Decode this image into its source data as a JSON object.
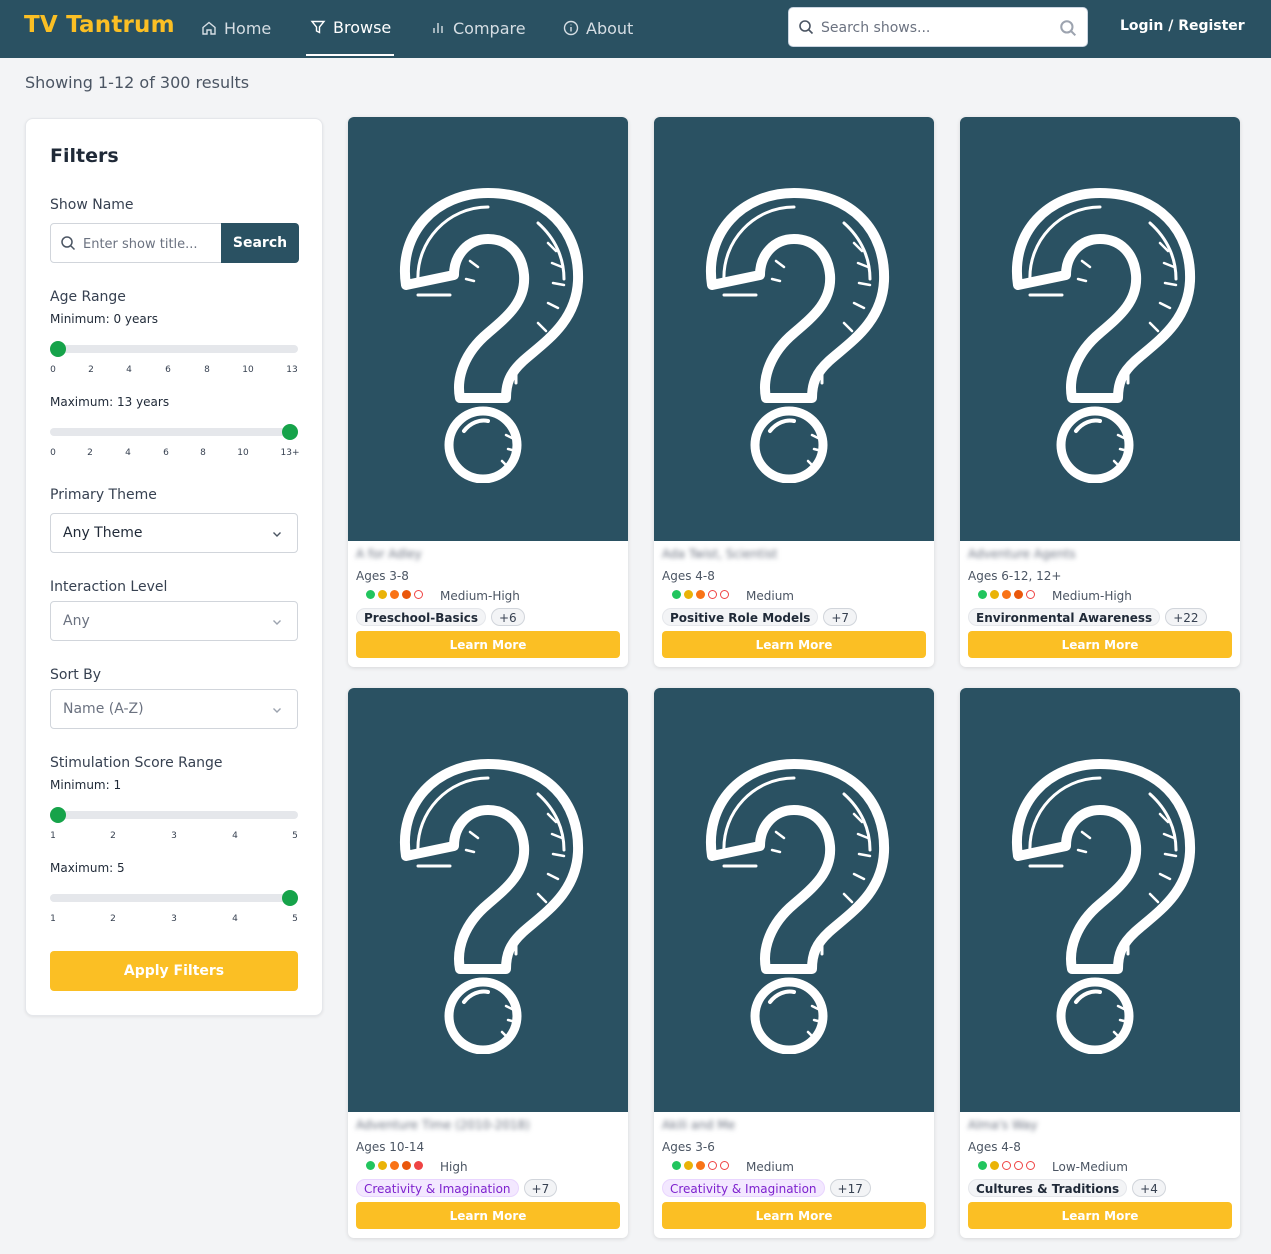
{
  "header": {
    "logo": "TV Tantrum",
    "nav": [
      {
        "label": "Home",
        "icon": "home-icon"
      },
      {
        "label": "Browse",
        "icon": "filter-icon"
      },
      {
        "label": "Compare",
        "icon": "bar-chart-icon"
      },
      {
        "label": "About",
        "icon": "info-icon"
      }
    ],
    "search_placeholder": "Search shows...",
    "login_label": "Login / Register"
  },
  "results_text": "Showing 1-12 of 300 results",
  "filters": {
    "title": "Filters",
    "show_name_label": "Show Name",
    "show_name_placeholder": "Enter show title...",
    "search_button": "Search",
    "age_range_label": "Age Range",
    "age_min_label": "Minimum: 0 years",
    "age_min_ticks": [
      "0",
      "2",
      "4",
      "6",
      "8",
      "10",
      "13"
    ],
    "age_max_label": "Maximum: 13 years",
    "age_max_ticks": [
      "0",
      "2",
      "4",
      "6",
      "8",
      "10",
      "13+"
    ],
    "age_min_value": 0,
    "age_max_value": 13,
    "primary_theme_label": "Primary Theme",
    "primary_theme_value": "Any Theme",
    "interaction_label": "Interaction Level",
    "interaction_value": "Any",
    "sort_label": "Sort By",
    "sort_value": "Name (A-Z)",
    "stim_label": "Stimulation Score Range",
    "stim_min_label": "Minimum: 1",
    "stim_max_label": "Maximum: 5",
    "stim_ticks": [
      "1",
      "2",
      "3",
      "4",
      "5"
    ],
    "stim_min_value": 1,
    "stim_max_value": 5,
    "apply_button": "Apply Filters"
  },
  "colors": {
    "header": "#2a5162",
    "accent": "#fbbf24",
    "slider_thumb": "#16a34a"
  },
  "cards": [
    {
      "title": "A for Adley",
      "ages": "Ages 3-8",
      "score": 4,
      "level": "Medium-High",
      "tag": "Preschool-Basics",
      "tag_style": "main",
      "more": "+6",
      "button": "Learn More"
    },
    {
      "title": "Ada Twist, Scientist",
      "ages": "Ages 4-8",
      "score": 3,
      "level": "Medium",
      "tag": "Positive Role Models",
      "tag_style": "main",
      "more": "+7",
      "button": "Learn More"
    },
    {
      "title": "Adventure Agents",
      "ages": "Ages 6-12, 12+",
      "score": 4,
      "level": "Medium-High",
      "tag": "Environmental Awareness",
      "tag_style": "main",
      "more": "+22",
      "button": "Learn More"
    },
    {
      "title": "Adventure Time (2010-2018)",
      "ages": "Ages 10-14",
      "score": 5,
      "level": "High",
      "tag": "Creativity & Imagination",
      "tag_style": "purple",
      "more": "+7",
      "button": "Learn More"
    },
    {
      "title": "Akili and Me",
      "ages": "Ages 3-6",
      "score": 3,
      "level": "Medium",
      "tag": "Creativity & Imagination",
      "tag_style": "purple",
      "more": "+17",
      "button": "Learn More"
    },
    {
      "title": "Alma's Way",
      "ages": "Ages 4-8",
      "score": 2,
      "level": "Low-Medium",
      "tag": "Cultures & Traditions",
      "tag_style": "main",
      "more": "+4",
      "button": "Learn More"
    }
  ]
}
